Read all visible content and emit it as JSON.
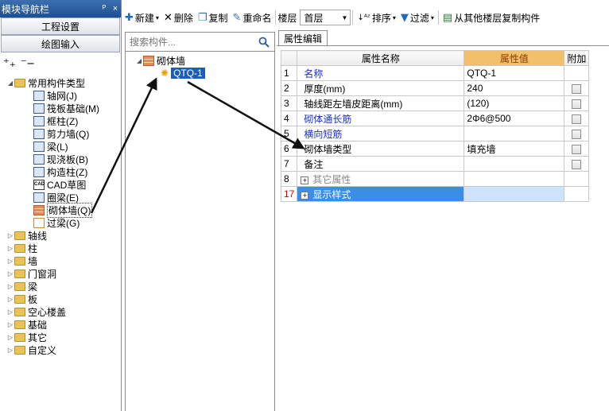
{
  "nav": {
    "title": "模块导航栏",
    "pin": "ᴾ",
    "close": "×",
    "btn_project_settings": "工程设置",
    "btn_drawing_input": "绘图输入",
    "tree": {
      "root": "常用构件类型",
      "children": [
        "轴网(J)",
        "筏板基础(M)",
        "框柱(Z)",
        "剪力墙(Q)",
        "梁(L)",
        "现浇板(B)",
        "构造柱(Z)",
        "CAD草图",
        "圈梁(E)",
        "砌体墙(Q)",
        "过梁(G)"
      ],
      "folders": [
        "轴线",
        "柱",
        "墙",
        "门窗洞",
        "梁",
        "板",
        "空心楼盖",
        "基础",
        "其它",
        "自定义"
      ]
    }
  },
  "toolbar": {
    "new": "新建",
    "delete": "删除",
    "copy": "复制",
    "rename": "重命名",
    "floor_label": "楼层",
    "floor_value": "首层",
    "sort": "排序",
    "filter": "过滤",
    "copy_from_floor": "从其他楼层复制构件"
  },
  "component": {
    "search_placeholder": "搜索构件...",
    "group": "砌体墙",
    "item": "QTQ-1"
  },
  "properties": {
    "tab": "属性编辑",
    "headers": {
      "name": "属性名称",
      "value": "属性值",
      "extra": "附加"
    },
    "rows": [
      {
        "num": "1",
        "name": "名称",
        "value": "QTQ-1"
      },
      {
        "num": "2",
        "name": "厚度(mm)",
        "value": "240"
      },
      {
        "num": "3",
        "name": "轴线距左墙皮距离(mm)",
        "value": "(120)"
      },
      {
        "num": "4",
        "name": "砌体通长筋",
        "value": "2Φ6@500"
      },
      {
        "num": "5",
        "name": "横向短筋",
        "value": ""
      },
      {
        "num": "6",
        "name": "砌体墙类型",
        "value": "填充墙"
      },
      {
        "num": "7",
        "name": "备注",
        "value": ""
      },
      {
        "num": "8",
        "name": "其它属性",
        "value": ""
      },
      {
        "num": "17",
        "name": "显示样式",
        "value": ""
      }
    ]
  }
}
